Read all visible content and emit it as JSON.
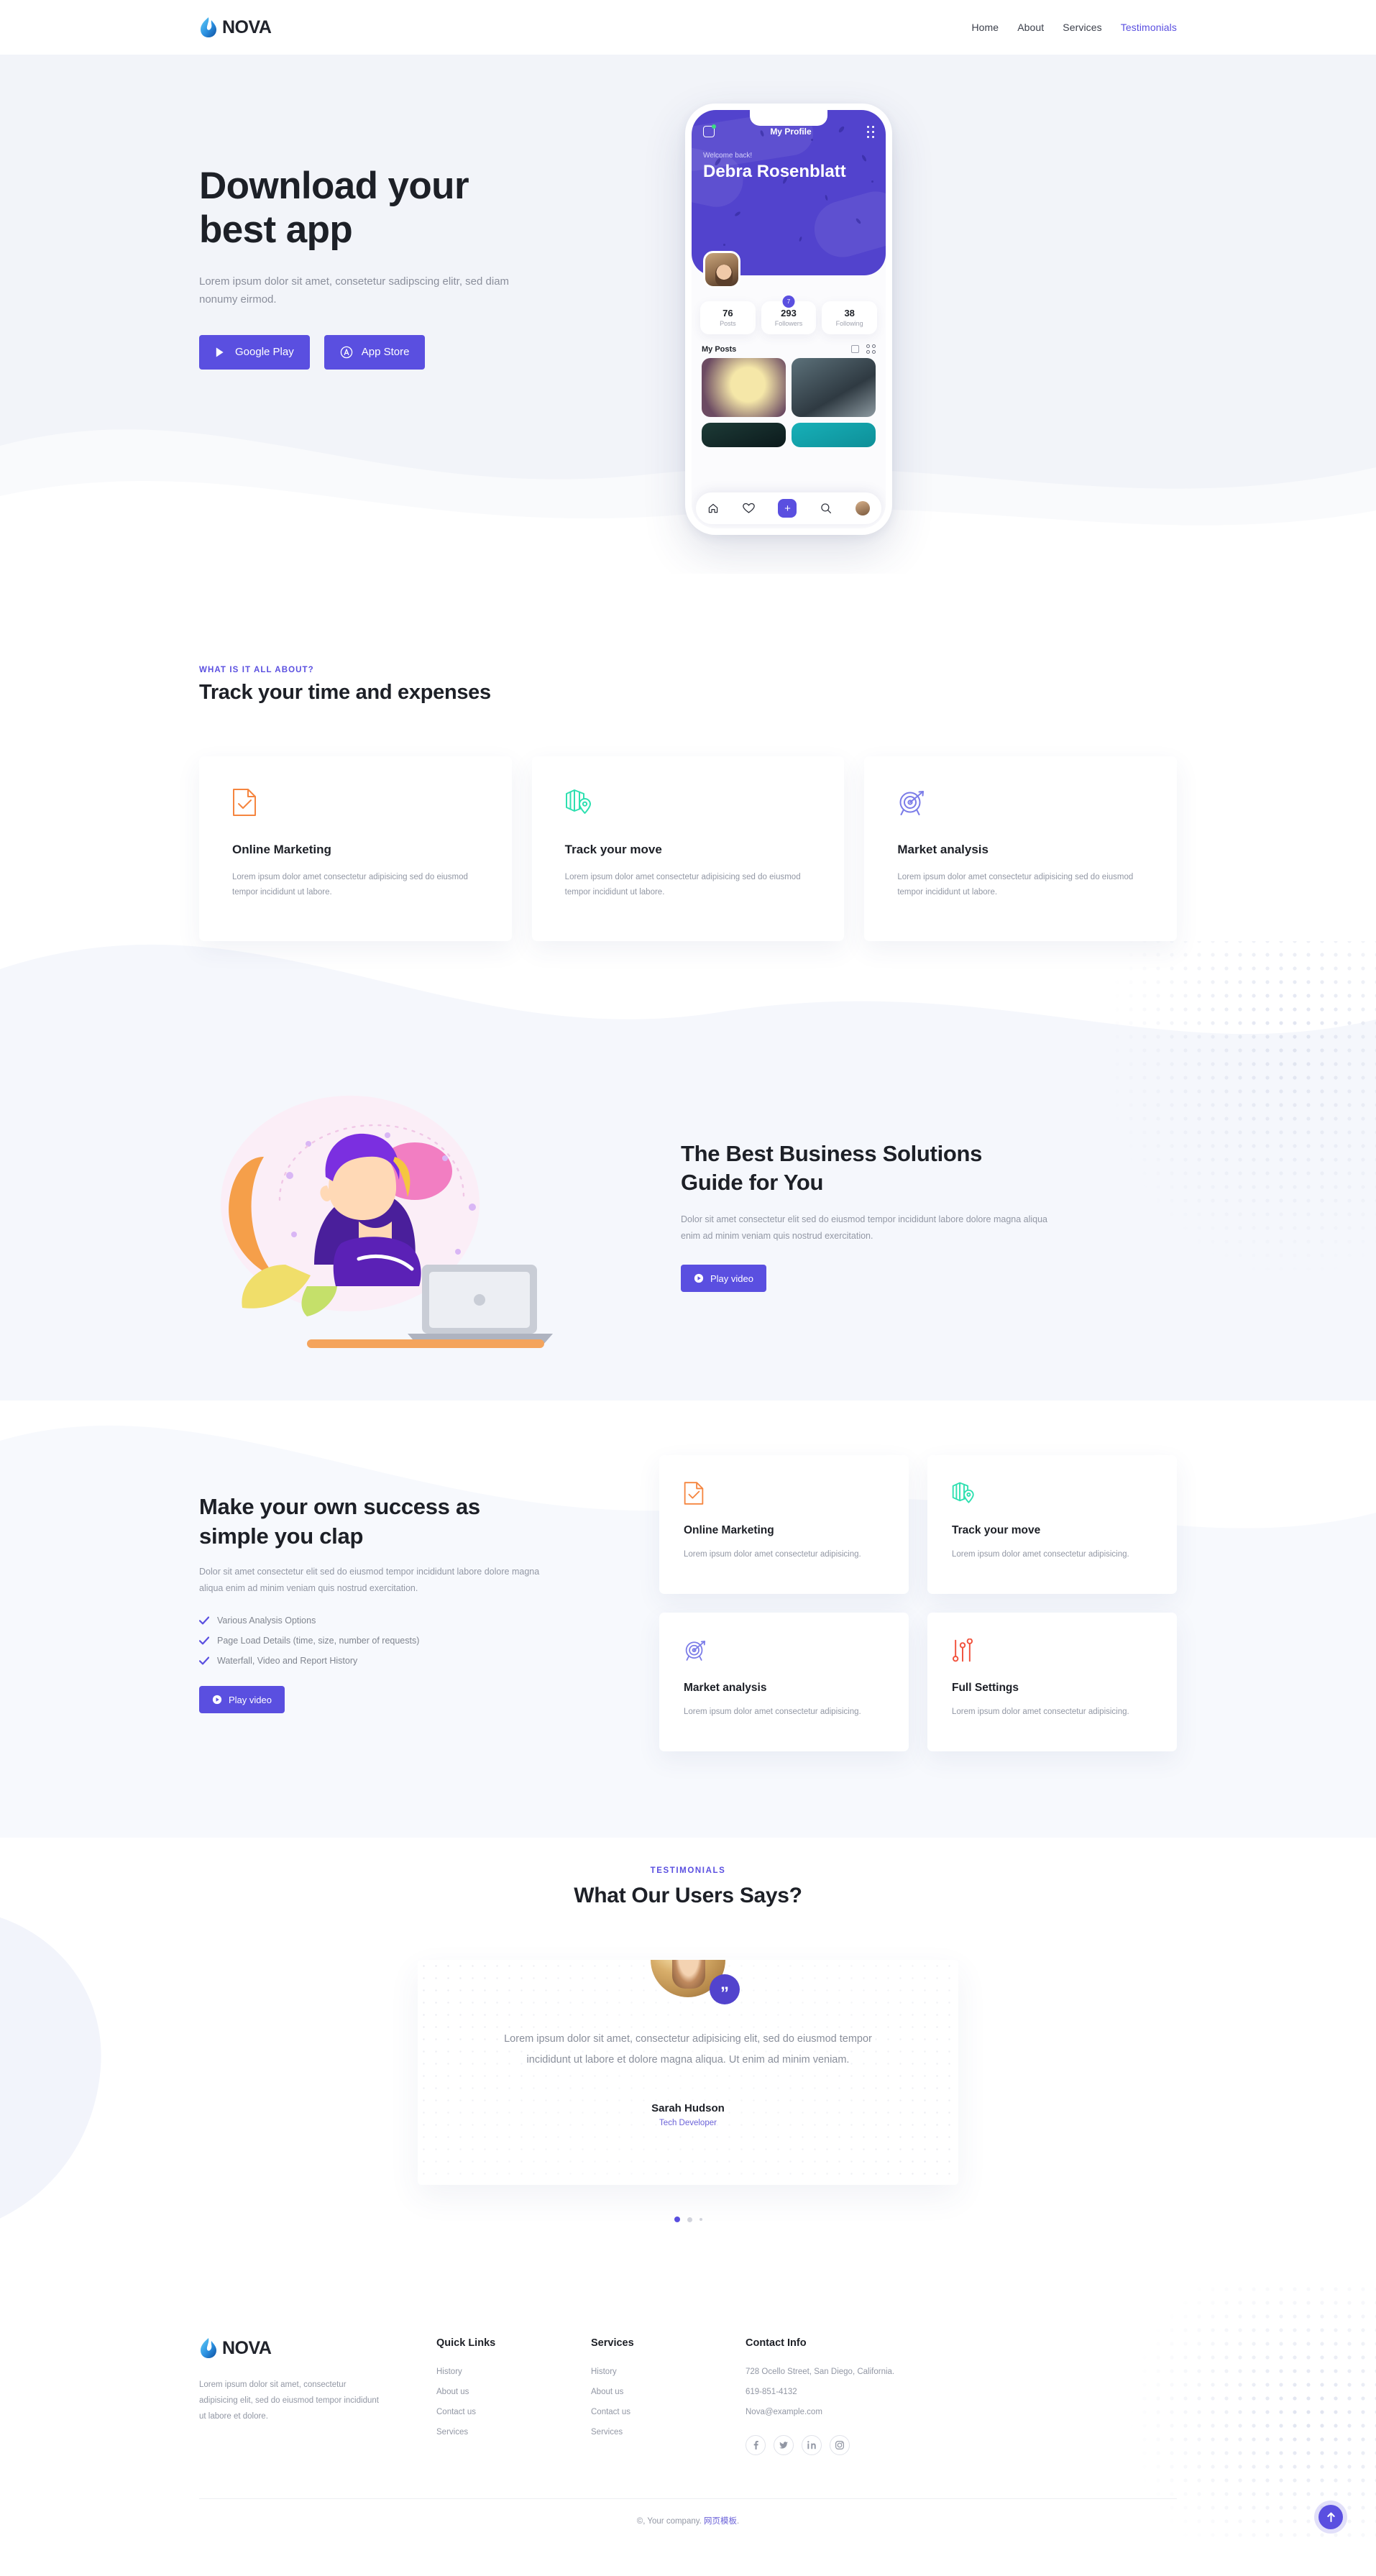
{
  "colors": {
    "accent": "#5a4fe0",
    "accent_deep": "#5243cd",
    "heading": "#1d2027",
    "muted": "#9297a4",
    "hero_bg": "#f2f4f9",
    "icon_orange": "#f5853f",
    "icon_teal": "#2ee0b0",
    "icon_purple": "#7b7ce8",
    "icon_red": "#f1543f"
  },
  "header": {
    "brand": "NOVA",
    "brand_icon": "flame-droplet-logo",
    "nav": [
      {
        "label": "Home",
        "active": false
      },
      {
        "label": "About",
        "active": false
      },
      {
        "label": "Services",
        "active": false
      },
      {
        "label": "Testimonials",
        "active": true
      }
    ]
  },
  "hero": {
    "title": "Download your best app",
    "subtitle": "Lorem ipsum dolor sit amet, consetetur sadipscing elitr, sed diam nonumy eirmod.",
    "buttons": [
      {
        "label": "Google Play",
        "icon": "google-play-icon"
      },
      {
        "label": "App Store",
        "icon": "apple-app-store-icon"
      }
    ],
    "phone": {
      "status_icon_left": "scan-icon",
      "title": "My Profile",
      "menu_icon": "grid-dots-icon",
      "welcome": "Welcome back!",
      "name": "Debra Rosenblatt",
      "avatar": "user-avatar",
      "badge": "7",
      "stats": [
        {
          "value": "76",
          "label": "Posts"
        },
        {
          "value": "293",
          "label": "Followers"
        },
        {
          "value": "38",
          "label": "Following"
        }
      ],
      "posts_label": "My Posts",
      "view_icons": [
        "single-column-view-icon",
        "grid-view-icon"
      ],
      "photos": [
        "cockatiel-photo",
        "elephant-photo",
        "dark-photo",
        "teal-photo"
      ],
      "tabs": [
        "home-icon",
        "heart-icon",
        "plus-icon",
        "search-icon",
        "profile-avatar-icon"
      ]
    }
  },
  "about": {
    "eyebrow": "WHAT IS IT ALL ABOUT?",
    "title": "Track your time and expenses",
    "cards": [
      {
        "icon": "document-check-icon",
        "title": "Online Marketing",
        "text": "Lorem ipsum dolor amet consectetur adipisicing sed do eiusmod tempor incididunt ut labore."
      },
      {
        "icon": "map-pin-icon",
        "title": "Track your move",
        "text": "Lorem ipsum dolor amet consectetur adipisicing sed do eiusmod tempor incididunt ut labore."
      },
      {
        "icon": "target-arrow-icon",
        "title": "Market analysis",
        "text": "Lorem ipsum dolor amet consectetur adipisicing sed do eiusmod tempor incididunt ut labore."
      }
    ]
  },
  "solutions": {
    "illustration": "woman-with-laptop-illustration",
    "title": "The Best Business Solutions Guide for You",
    "text": "Dolor sit amet consectetur elit sed do eiusmod tempor incididunt labore dolore magna aliqua enim ad minim veniam quis nostrud exercitation.",
    "button": {
      "label": "Play video",
      "icon": "play-circle-icon"
    }
  },
  "success": {
    "title": "Make your own success as simple you clap",
    "text": "Dolor sit amet consectetur elit sed do eiusmod tempor incididunt labore dolore magna aliqua enim ad minim veniam quis nostrud exercitation.",
    "checks": [
      "Various Analysis Options",
      "Page Load Details (time, size, number of requests)",
      "Waterfall, Video and Report History"
    ],
    "button": {
      "label": "Play video",
      "icon": "play-circle-icon"
    },
    "cards": [
      {
        "icon": "document-check-icon",
        "title": "Online Marketing",
        "text": "Lorem ipsum dolor amet consectetur adipisicing."
      },
      {
        "icon": "map-pin-icon",
        "title": "Track your move",
        "text": "Lorem ipsum dolor amet consectetur adipisicing."
      },
      {
        "icon": "target-arrow-icon",
        "title": "Market analysis",
        "text": "Lorem ipsum dolor amet consectetur adipisicing."
      },
      {
        "icon": "sliders-icon",
        "title": "Full Settings",
        "text": "Lorem ipsum dolor amet consectetur adipisicing."
      }
    ]
  },
  "testimonials": {
    "eyebrow": "TESTIMONIALS",
    "title": "What Our Users Says?",
    "avatar": "sarah-hudson-avatar",
    "quote_icon": "quote-mark-icon",
    "body": "Lorem ipsum dolor sit amet, consectetur adipisicing elit, sed do eiusmod tempor incididunt ut labore et dolore magna aliqua. Ut enim ad minim veniam.",
    "name": "Sarah Hudson",
    "role": "Tech Developer",
    "slide_count": 3,
    "active_slide": 1
  },
  "footer": {
    "brand": "NOVA",
    "brand_icon": "flame-droplet-logo",
    "description": "Lorem ipsum dolor sit amet, consectetur adipisicing elit, sed do eiusmod tempor incididunt ut labore et dolore.",
    "quick_links": {
      "heading": "Quick Links",
      "items": [
        "History",
        "About us",
        "Contact us",
        "Services"
      ]
    },
    "services": {
      "heading": "Services",
      "items": [
        "History",
        "About us",
        "Contact us",
        "Services"
      ]
    },
    "contact": {
      "heading": "Contact Info",
      "address": "728 Ocello Street, San Diego, California.",
      "phone": "619-851-4132",
      "email": "Nova@example.com",
      "socials": [
        "facebook-icon",
        "twitter-icon",
        "linkedin-icon",
        "instagram-icon"
      ]
    },
    "copyright_prefix": "©, Your company. ",
    "copyright_link": "网页模板",
    "copyright_suffix": ".",
    "scroll_top_icon": "arrow-up-icon"
  }
}
